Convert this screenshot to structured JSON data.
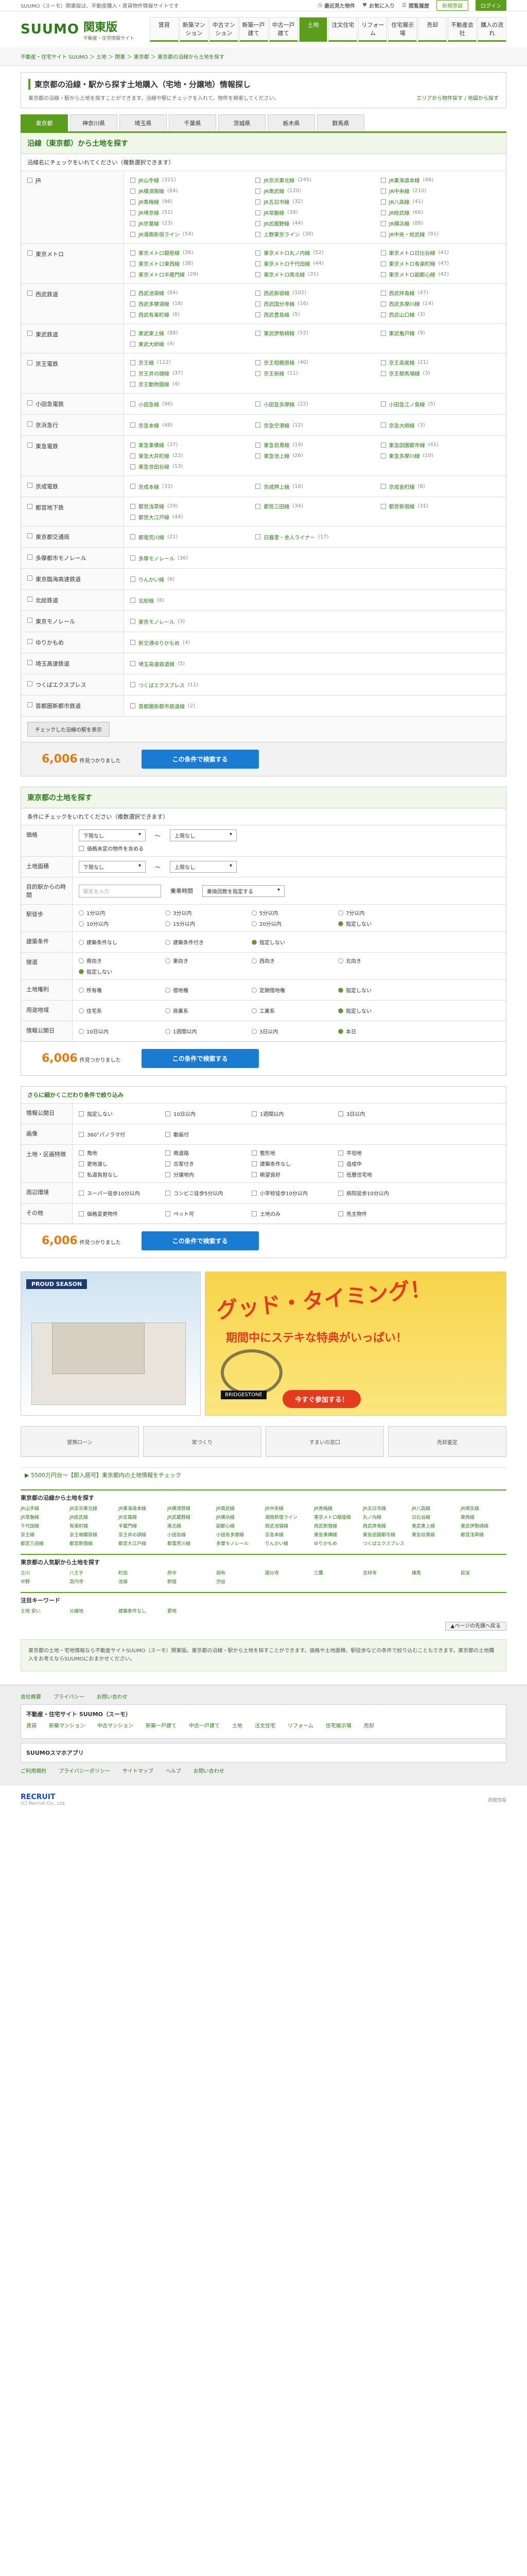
{
  "topbar": {
    "left": "SUUMO（スーモ）関東版は、不動産購入・賃貸物件情報サイトです",
    "links": [
      "最近見た物件",
      "お気に入り",
      "閲覧履歴",
      "保存した条件"
    ],
    "register": "新規登録",
    "login": "ログイン"
  },
  "header": {
    "brand": "SUUMO",
    "region": "関東版",
    "subtitle": "不動産・住宅情報サイト",
    "nav": [
      "賃貸",
      "新築マンション",
      "中古マンション",
      "新築一戸建て",
      "中古一戸建て",
      "土地",
      "注文住宅",
      "リフォーム",
      "住宅展示場",
      "売却",
      "不動産会社",
      "購入の流れ"
    ],
    "active_nav": "土地"
  },
  "breadcrumb": "不動産・住宅サイト SUUMO ＞ 土地 ＞ 関東 ＞ 東京都 ＞ 東京都の沿線から土地を探す",
  "title": "東京都の沿線・駅から探す土地購入（宅地・分譲地）情報探し",
  "title_desc": "東京都の沿線・駅から土地を探すことができます。沿線や駅にチェックを入れて、物件を検索してください。",
  "title_link1": "エリアから物件探す",
  "title_link2": "地図から探す",
  "region_tabs": [
    "東京都",
    "神奈川県",
    "埼玉県",
    "千葉県",
    "茨城県",
    "栃木県",
    "群馬県"
  ],
  "active_region": "東京都",
  "line_section": {
    "heading": "沿線（東京都）から土地を探す",
    "hint": "沿線名にチェックをいれてください（複数選択できます）",
    "groups": [
      {
        "company": "JR",
        "lines": [
          [
            "JR山手線",
            "(321)"
          ],
          [
            "JR京浜東北線",
            "(245)"
          ],
          [
            "JR東海道本線",
            "(48)"
          ],
          [
            "JR横須賀線",
            "(64)"
          ],
          [
            "JR南武線",
            "(120)"
          ],
          [
            "JR中央線",
            "(210)"
          ],
          [
            "JR青梅線",
            "(96)"
          ],
          [
            "JR五日市線",
            "(32)"
          ],
          [
            "JR八高線",
            "(41)"
          ],
          [
            "JR埼京線",
            "(51)"
          ],
          [
            "JR常磐線",
            "(39)"
          ],
          [
            "JR総武線",
            "(66)"
          ],
          [
            "JR京葉線",
            "(23)"
          ],
          [
            "JR武蔵野線",
            "(44)"
          ],
          [
            "JR横浜線",
            "(88)"
          ],
          [
            "JR湘南新宿ライン",
            "(54)"
          ],
          [
            "上野東京ライン",
            "(30)"
          ],
          [
            "JR中央・総武線",
            "(91)"
          ]
        ]
      },
      {
        "company": "東京メトロ",
        "lines": [
          [
            "東京メトロ銀座線",
            "(36)"
          ],
          [
            "東京メトロ丸ノ内線",
            "(52)"
          ],
          [
            "東京メトロ日比谷線",
            "(41)"
          ],
          [
            "東京メトロ東西線",
            "(38)"
          ],
          [
            "東京メトロ千代田線",
            "(44)"
          ],
          [
            "東京メトロ有楽町線",
            "(47)"
          ],
          [
            "東京メトロ半蔵門線",
            "(28)"
          ],
          [
            "東京メトロ南北線",
            "(31)"
          ],
          [
            "東京メトロ副都心線",
            "(42)"
          ]
        ]
      },
      {
        "company": "西武鉄道",
        "lines": [
          [
            "西武池袋線",
            "(84)"
          ],
          [
            "西武新宿線",
            "(102)"
          ],
          [
            "西武拝島線",
            "(47)"
          ],
          [
            "西武多摩湖線",
            "(18)"
          ],
          [
            "西武国分寺線",
            "(16)"
          ],
          [
            "西武多摩川線",
            "(14)"
          ],
          [
            "西武有楽町線",
            "(6)"
          ],
          [
            "西武豊島線",
            "(5)"
          ],
          [
            "西武山口線",
            "(3)"
          ]
        ]
      },
      {
        "company": "東武鉄道",
        "lines": [
          [
            "東武東上線",
            "(88)"
          ],
          [
            "東武伊勢崎線",
            "(52)"
          ],
          [
            "東武亀戸線",
            "(9)"
          ],
          [
            "東武大師線",
            "(4)"
          ]
        ]
      },
      {
        "company": "京王電鉄",
        "lines": [
          [
            "京王線",
            "(112)"
          ],
          [
            "京王相模原線",
            "(40)"
          ],
          [
            "京王高尾線",
            "(21)"
          ],
          [
            "京王井の頭線",
            "(37)"
          ],
          [
            "京王新線",
            "(11)"
          ],
          [
            "京王競馬場線",
            "(3)"
          ],
          [
            "京王動物園線",
            "(4)"
          ]
        ]
      },
      {
        "company": "小田急電鉄",
        "lines": [
          [
            "小田急線",
            "(96)"
          ],
          [
            "小田急多摩線",
            "(22)"
          ],
          [
            "小田急江ノ島線",
            "(5)"
          ]
        ]
      },
      {
        "company": "京浜急行",
        "lines": [
          [
            "京急本線",
            "(48)"
          ],
          [
            "京急空港線",
            "(12)"
          ],
          [
            "京急大師線",
            "(3)"
          ]
        ]
      },
      {
        "company": "東急電鉄",
        "lines": [
          [
            "東急東横線",
            "(37)"
          ],
          [
            "東急目黒線",
            "(19)"
          ],
          [
            "東急田園都市線",
            "(41)"
          ],
          [
            "東急大井町線",
            "(22)"
          ],
          [
            "東急池上線",
            "(26)"
          ],
          [
            "東急多摩川線",
            "(10)"
          ],
          [
            "東急世田谷線",
            "(13)"
          ]
        ]
      },
      {
        "company": "京成電鉄",
        "lines": [
          [
            "京成本線",
            "(33)"
          ],
          [
            "京成押上線",
            "(16)"
          ],
          [
            "京成金町線",
            "(6)"
          ]
        ]
      },
      {
        "company": "都営地下鉄",
        "lines": [
          [
            "都営浅草線",
            "(29)"
          ],
          [
            "都営三田線",
            "(34)"
          ],
          [
            "都営新宿線",
            "(31)"
          ],
          [
            "都営大江戸線",
            "(44)"
          ]
        ]
      },
      {
        "company": "東京都交通局",
        "lines": [
          [
            "都電荒川線",
            "(21)"
          ],
          [
            "日暮里・舎人ライナー",
            "(17)"
          ]
        ]
      },
      {
        "company": "多摩都市モノレール",
        "lines": [
          [
            "多摩モノレール",
            "(36)"
          ]
        ]
      },
      {
        "company": "東京臨海高速鉄道",
        "lines": [
          [
            "りんかい線",
            "(6)"
          ]
        ]
      },
      {
        "company": "北総鉄道",
        "lines": [
          [
            "北総線",
            "(8)"
          ]
        ]
      },
      {
        "company": "東京モノレール",
        "lines": [
          [
            "東京モノレール",
            "(3)"
          ]
        ]
      },
      {
        "company": "ゆりかもめ",
        "lines": [
          [
            "新交通ゆりかもめ",
            "(4)"
          ]
        ]
      },
      {
        "company": "埼玉高速鉄道",
        "lines": [
          [
            "埼玉高速鉄道線",
            "(5)"
          ]
        ]
      },
      {
        "company": "つくばエクスプレス",
        "lines": [
          [
            "つくばエクスプレス",
            "(11)"
          ]
        ]
      },
      {
        "company": "首都圏新都市鉄道",
        "lines": [
          [
            "首都圏新都市鉄道線",
            "(2)"
          ]
        ]
      }
    ],
    "clear_button": "チェックした沿線の駅を表示",
    "count": "6,006",
    "count_suffix": "件見つかりました",
    "search_button": "この条件で検索する"
  },
  "detail": {
    "heading": "東京都の土地を探す",
    "hint": "条件にチェックをいれてください（複数選択できます）",
    "rows": {
      "price": {
        "label": "価格",
        "from": "下限なし",
        "to": "上限なし",
        "option": "価格未定の物件を含める"
      },
      "area": {
        "label": "土地面積",
        "from": "下限なし",
        "to": "上限なし"
      },
      "walk": {
        "label": "駅徒歩",
        "items": [
          "1分以内",
          "3分以内",
          "5分以内",
          "7分以内",
          "10分以内",
          "15分以内",
          "20分以内",
          "指定しない"
        ]
      },
      "commute": {
        "label": "目的駅からの時間",
        "placeholder": "駅名を入力",
        "unit": "乗車時間",
        "sel": "乗換回数を指定する"
      },
      "status": {
        "label": "建築条件",
        "items": [
          "建築条件なし",
          "建築条件付き",
          "指定しない"
        ]
      },
      "direction": {
        "label": "接道",
        "items": [
          "南向き",
          "東向き",
          "西向き",
          "北向き",
          "指定しない"
        ]
      },
      "right": {
        "label": "土地権利",
        "items": [
          "所有権",
          "借地権",
          "定期借地権",
          "指定しない"
        ]
      },
      "age": {
        "label": "用途地域",
        "items": [
          "住宅系",
          "商業系",
          "工業系",
          "指定しない"
        ]
      },
      "other": {
        "label": "情報公開日",
        "items": [
          "10日以内",
          "1週間以内",
          "3日以内",
          "本日"
        ]
      }
    },
    "count": "6,006",
    "count_suffix": "件見つかりました",
    "search_button": "この条件で検索する",
    "more_heading": "さらに細かくこだわり条件で絞り込み",
    "more": [
      {
        "label": "情報公開日",
        "items": [
          "指定しない",
          "10日以内",
          "1週間以内",
          "3日以内"
        ]
      },
      {
        "label": "画像",
        "items": [
          "360°パノラマ付",
          "動画付"
        ]
      },
      {
        "label": "土地・区画特徴",
        "items": [
          "角地",
          "南道路",
          "整形地",
          "平坦地",
          "更地渡し",
          "古家付き",
          "建築条件なし",
          "造成中",
          "私道負担なし",
          "分譲地内",
          "眺望良好",
          "低層住宅地"
        ]
      },
      {
        "label": "周辺環境",
        "items": [
          "スーパー徒歩10分以内",
          "コンビニ徒歩5分以内",
          "小学校徒歩10分以内",
          "病院徒歩10分以内"
        ]
      },
      {
        "label": "その他",
        "items": [
          "価格変更物件",
          "ペット可",
          "土地のみ",
          "売主物件"
        ]
      }
    ],
    "count2": "6,006",
    "search_button2": "この条件で検索する"
  },
  "ads": {
    "left_tag": "PROUD SEASON",
    "right_title": "グッド・タイミング！",
    "right_sub": "期間中にステキな特典がいっぱい！",
    "right_cta": "今すぐ参加する！",
    "right_brand": "BRIDGESTONE"
  },
  "small_banners": [
    "提携ローン",
    "家づくり",
    "すまいの窓口",
    "売却査定"
  ],
  "news": "5500万円台～【即入居可】東京都内の土地情報をチェック",
  "station_links": {
    "heading": "東京都の沿線から土地を探す",
    "items": [
      "JR山手線",
      "JR京浜東北線",
      "JR東海道本線",
      "JR横須賀線",
      "JR南武線",
      "JR中央線",
      "JR青梅線",
      "JR五日市線",
      "JR八高線",
      "JR埼京線",
      "JR常磐線",
      "JR総武線",
      "JR京葉線",
      "JR武蔵野線",
      "JR横浜線",
      "湘南新宿ライン",
      "東京メトロ銀座線",
      "丸ノ内線",
      "日比谷線",
      "東西線",
      "千代田線",
      "有楽町線",
      "半蔵門線",
      "南北線",
      "副都心線",
      "西武池袋線",
      "西武新宿線",
      "西武拝島線",
      "東武東上線",
      "東武伊勢崎線",
      "京王線",
      "京王相模原線",
      "京王井の頭線",
      "小田急線",
      "小田急多摩線",
      "京急本線",
      "東急東横線",
      "東急田園都市線",
      "東急目黒線",
      "都営浅草線",
      "都営三田線",
      "都営新宿線",
      "都営大江戸線",
      "都電荒川線",
      "多摩モノレール",
      "りんかい線",
      "ゆりかもめ",
      "つくばエクスプレス"
    ]
  },
  "pop_stations": {
    "heading": "東京都の人気駅から土地を探す",
    "items": [
      "立川",
      "八王子",
      "町田",
      "府中",
      "調布",
      "国分寺",
      "三鷹",
      "吉祥寺",
      "練馬",
      "荻窪",
      "中野",
      "高円寺",
      "池袋",
      "新宿",
      "渋谷"
    ]
  },
  "keywords": {
    "heading": "注目キーワード",
    "items": [
      "土地 安い",
      "分譲地",
      "建築条件なし",
      "更地"
    ]
  },
  "pager": "▲ページの先頭へ戻る",
  "info": "東京都の土地・宅地情報なら不動産サイトSUUMO（スーモ）関東版。東京都の沿線・駅から土地を探すことができます。価格や土地面積、駅徒歩などの条件で絞り込むこともできます。東京都の土地購入をお考えならSUUMOにおまかせください。",
  "bottom": {
    "row1": [
      "会社概要",
      "プライバシー",
      "お問い合わせ"
    ],
    "box_title": "不動産・住宅サイト SUUMO（スーモ）",
    "box_items": [
      "賃貸",
      "新築マンション",
      "中古マンション",
      "新築一戸建て",
      "中古一戸建て",
      "土地",
      "注文住宅",
      "リフォーム",
      "住宅展示場",
      "売却"
    ],
    "box2_title": "SUUMOスマホアプリ",
    "links": [
      "ご利用規約",
      "プライバシーポリシー",
      "サイトマップ",
      "ヘルプ",
      "お問い合わせ"
    ]
  },
  "footer": {
    "company": "RECRUIT",
    "tagline": "(C) Recruit Co., Ltd.",
    "copyright": "掲載情報"
  }
}
